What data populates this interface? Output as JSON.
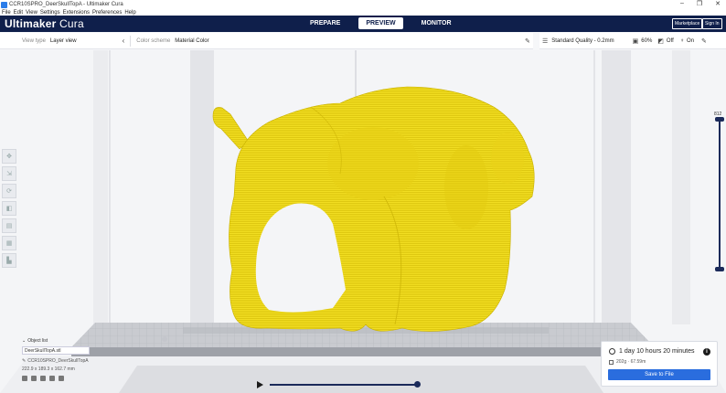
{
  "window": {
    "title": "CCR10SPRO_DeerSkullTopA - Ultimaker Cura",
    "controls": [
      "–",
      "❐",
      "✕"
    ]
  },
  "menu": [
    "File",
    "Edit",
    "View",
    "Settings",
    "Extensions",
    "Preferences",
    "Help"
  ],
  "header": {
    "brand_bold": "Ultimaker",
    "brand_light": " Cura",
    "tabs": [
      {
        "label": "PREPARE"
      },
      {
        "label": "PREVIEW"
      },
      {
        "label": "MONITOR"
      }
    ],
    "marketplace_label": "Marketplace",
    "signin_label": "Sign In"
  },
  "view_toolbar": {
    "view_type_label": "View type",
    "view_type_value": "Layer view",
    "color_scheme_label": "Color scheme",
    "color_scheme_value": "Material Color"
  },
  "print_settings": {
    "profile": "Standard Quality - 0.2mm",
    "infill": "60%",
    "support": "Off",
    "adhesion": "On"
  },
  "layers": {
    "max_layer": "812"
  },
  "object_list": {
    "header": "Object list",
    "object_name": "DeerSkullTopA.stl",
    "job_name": "CCR10SPRO_DeerSkullTopA",
    "dimensions": "222.9 x 189.3 x 162.7 mm"
  },
  "print_info": {
    "time": "1 day 10 hours 20 minutes",
    "material": "202g · 67.59m",
    "save_label": "Save to File"
  },
  "colors": {
    "header_bg": "#0f1f4b",
    "accent": "#2a6dde",
    "model_yellow": "#f0dc1e"
  }
}
